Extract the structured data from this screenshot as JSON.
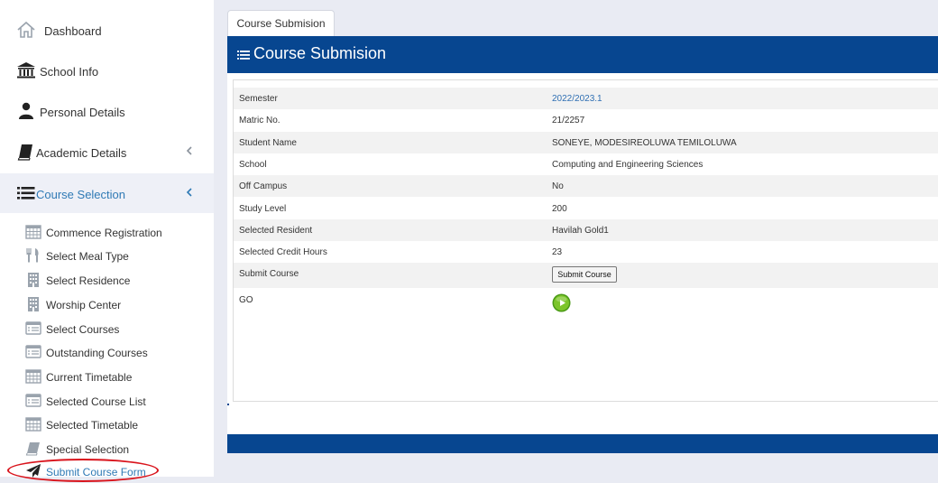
{
  "sidebar": {
    "items": [
      {
        "label": "Dashboard",
        "icon": "home-icon"
      },
      {
        "label": "School Info",
        "icon": "bank-icon"
      },
      {
        "label": "Personal Details",
        "icon": "user-icon"
      },
      {
        "label": "Academic Details",
        "icon": "book-icon"
      },
      {
        "label": "Course Selection",
        "icon": "list-icon"
      }
    ],
    "subitems": [
      {
        "label": "Commence Registration",
        "icon": "calendar-icon"
      },
      {
        "label": "Select Meal Type",
        "icon": "cutlery-icon"
      },
      {
        "label": "Select Residence",
        "icon": "building-icon"
      },
      {
        "label": "Worship Center",
        "icon": "building-icon"
      },
      {
        "label": "Select Courses",
        "icon": "list-alt-icon"
      },
      {
        "label": "Outstanding Courses",
        "icon": "list-alt-icon"
      },
      {
        "label": "Current Timetable",
        "icon": "calendar-icon"
      },
      {
        "label": "Selected Course List",
        "icon": "list-alt-icon"
      },
      {
        "label": "Selected Timetable",
        "icon": "calendar-icon"
      },
      {
        "label": "Special Selection",
        "icon": "book-icon"
      },
      {
        "label": "Submit Course Form",
        "icon": "send-icon"
      }
    ],
    "active_color": "#2f7ab5"
  },
  "tab": {
    "label": "Course Submision"
  },
  "panel": {
    "title": "Course Submision",
    "header_color": "#074690",
    "rows": [
      {
        "key": "Semester",
        "value": "2022/2023.1"
      },
      {
        "key": "Matric No.",
        "value": "21/2257"
      },
      {
        "key": "Student Name",
        "value": "SONEYE, MODESIREOLUWA TEMILOLUWA"
      },
      {
        "key": "School",
        "value": "Computing and Engineering Sciences"
      },
      {
        "key": "Off Campus",
        "value": "No"
      },
      {
        "key": "Study Level",
        "value": "200"
      },
      {
        "key": "Selected Resident",
        "value": "Havilah Gold1"
      },
      {
        "key": "Selected Credit Hours",
        "value": "23"
      },
      {
        "key": "Submit Course",
        "button": "Submit Course"
      },
      {
        "key": "GO",
        "icon": "go-arrow-icon"
      }
    ]
  }
}
